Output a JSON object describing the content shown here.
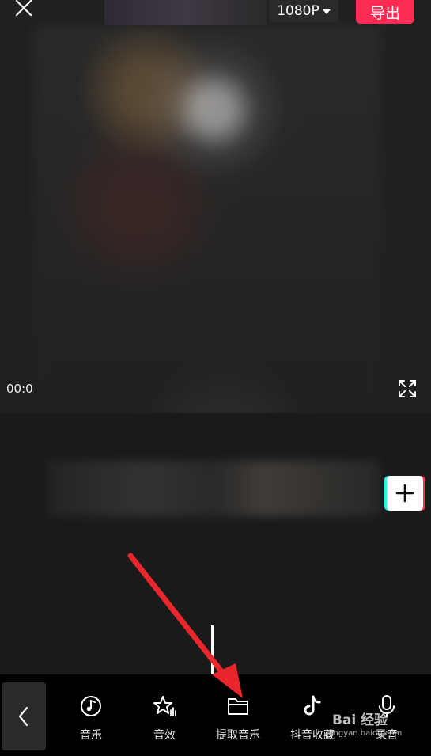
{
  "top_bar": {
    "resolution_label": "1080P",
    "export_label": "导出"
  },
  "preview": {
    "timecode": "00:0"
  },
  "toolbar": {
    "items": [
      {
        "label": "音乐",
        "icon": "music-note-icon"
      },
      {
        "label": "音效",
        "icon": "sound-effect-star-icon"
      },
      {
        "label": "提取音乐",
        "icon": "folder-icon"
      },
      {
        "label": "抖音收藏",
        "icon": "tiktok-icon"
      },
      {
        "label": "录音",
        "icon": "microphone-icon"
      }
    ]
  },
  "watermark": {
    "brand": "Bai 经验",
    "url": "jingyan.baidu.com"
  },
  "colors": {
    "accent": "#fe2c55",
    "accent_cyan": "#25f4ee",
    "annotation_arrow": "#e8262b"
  }
}
